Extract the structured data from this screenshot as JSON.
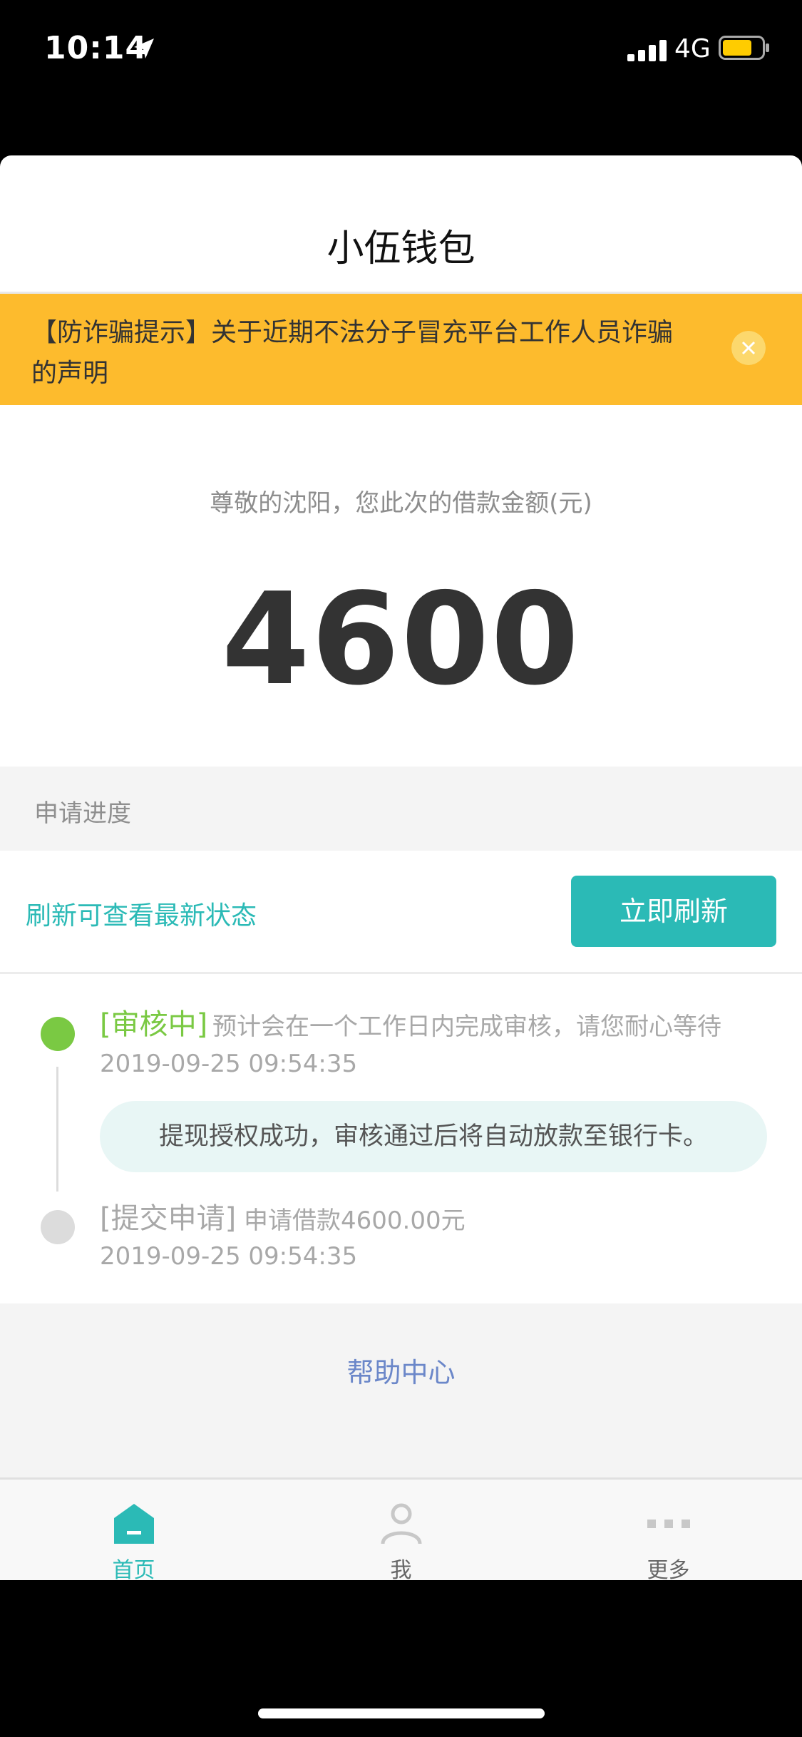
{
  "status_bar": {
    "time": "10:14",
    "network": "4G"
  },
  "app": {
    "title": "小伍钱包"
  },
  "notice": {
    "text": "【防诈骗提示】关于近期不法分子冒充平台工作人员诈骗的声明"
  },
  "loan": {
    "greeting": "尊敬的沈阳，您此次的借款金额(元)",
    "amount": "4600"
  },
  "progress": {
    "header": "申请进度",
    "refresh_tip": "刷新可查看最新状态",
    "refresh_button": "立即刷新",
    "events": [
      {
        "status": "[审核中]",
        "desc": "预计会在一个工作日内完成审核，请您耐心等待",
        "time": "2019-09-25 09:54:35",
        "note": "提现授权成功，审核通过后将自动放款至银行卡。"
      },
      {
        "status": "[提交申请]",
        "desc": "申请借款4600.00元",
        "time": "2019-09-25 09:54:35"
      }
    ]
  },
  "help": {
    "label": "帮助中心"
  },
  "tabs": [
    {
      "label": "首页",
      "icon": "home-icon",
      "active": true
    },
    {
      "label": "我",
      "icon": "user-icon",
      "active": false
    },
    {
      "label": "更多",
      "icon": "more-icon",
      "active": false
    }
  ],
  "colors": {
    "accent": "#2bbab6",
    "warning": "#fdbb2d",
    "success": "#7ac943",
    "link": "#6b87c9"
  }
}
